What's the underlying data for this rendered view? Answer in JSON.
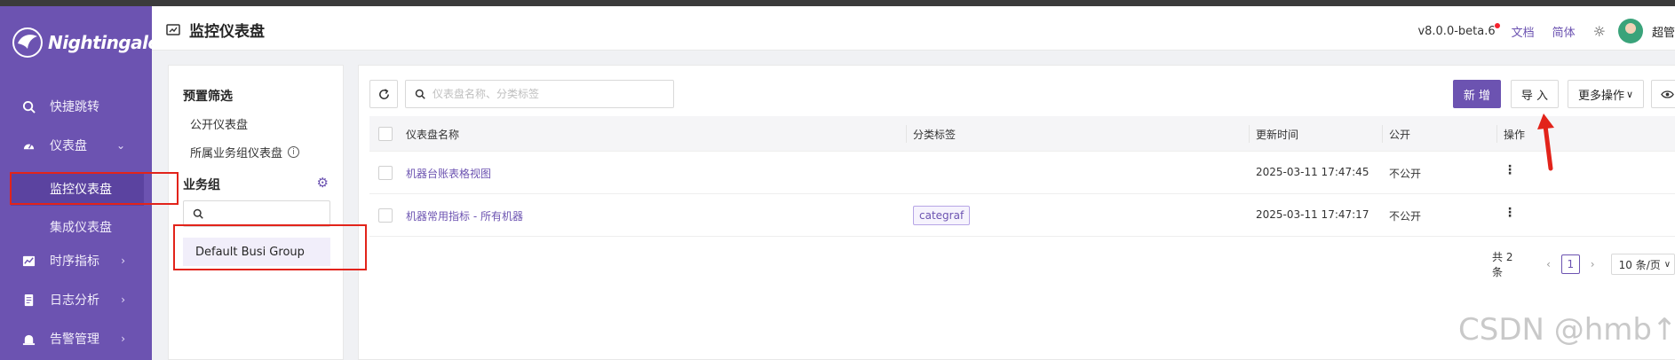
{
  "app": {
    "brand": "Nightingale"
  },
  "sidebar": {
    "items": [
      {
        "label": "快捷跳转",
        "icon": "search-icon"
      },
      {
        "label": "仪表盘",
        "icon": "dashboard-icon"
      },
      {
        "label": "监控仪表盘",
        "sub": true,
        "active": true
      },
      {
        "label": "集成仪表盘",
        "sub": true
      },
      {
        "label": "时序指标",
        "icon": "chart-line-icon"
      },
      {
        "label": "日志分析",
        "icon": "log-icon"
      },
      {
        "label": "告警管理",
        "icon": "alarm-icon"
      }
    ]
  },
  "header": {
    "title": "监控仪表盘",
    "version": "v8.0.0-beta.6",
    "docs": "文档",
    "lang": "简体",
    "user": "超管"
  },
  "filters": {
    "preset_title": "预置筛选",
    "public": "公开仪表盘",
    "mine": "所属业务组仪表盘",
    "group_title": "业务组",
    "search_value": "",
    "group_item": "Default Busi Group"
  },
  "toolbar": {
    "search_placeholder": "仪表盘名称、分类标签",
    "add": "新 增",
    "import": "导 入",
    "more": "更多操作"
  },
  "table": {
    "columns": [
      "仪表盘名称",
      "分类标签",
      "更新时间",
      "公开",
      "操作"
    ],
    "rows": [
      {
        "name": "机器台账表格视图",
        "tag": "",
        "updated": "2025-03-11 17:47:45",
        "public": "不公开"
      },
      {
        "name": "机器常用指标 - 所有机器",
        "tag": "categraf",
        "updated": "2025-03-11 17:47:17",
        "public": "不公开"
      }
    ]
  },
  "pagination": {
    "total": "共 2 条",
    "current": "1",
    "size": "10 条/页"
  },
  "watermark": "CSDN @hmb↑",
  "colors": {
    "brand": "#6c53b1",
    "highlight": "#e2231a"
  }
}
